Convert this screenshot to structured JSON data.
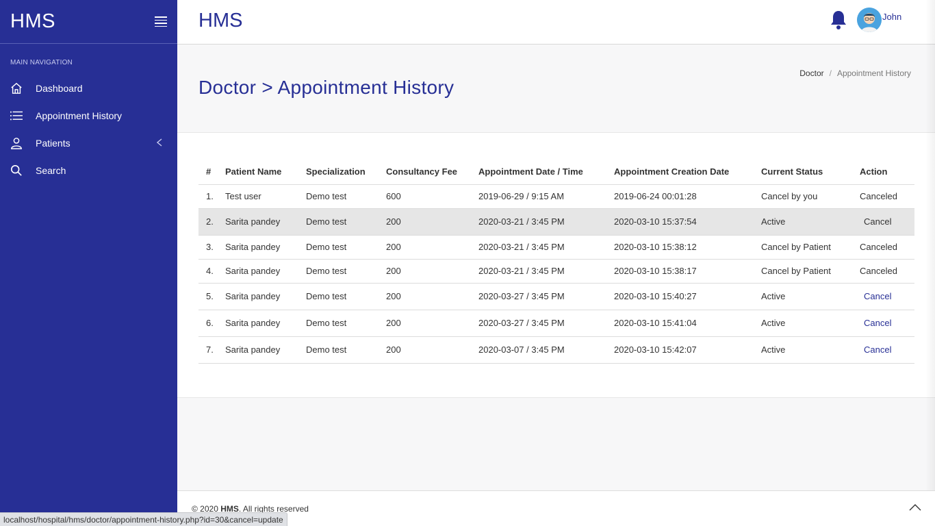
{
  "brand": "HMS",
  "sidebar": {
    "section_title": "Main Navigation",
    "items": [
      {
        "label": "Dashboard",
        "icon": "home-icon"
      },
      {
        "label": "Appointment History",
        "icon": "list-icon"
      },
      {
        "label": "Patients",
        "icon": "user-icon"
      },
      {
        "label": "Search",
        "icon": "search-icon"
      }
    ]
  },
  "topbar": {
    "title": "HMS",
    "username": "John"
  },
  "page": {
    "heading": "Doctor > Appointment History",
    "breadcrumb": [
      "Doctor",
      "Appointment History"
    ]
  },
  "table": {
    "headers": [
      "#",
      "Patient Name",
      "Specialization",
      "Consultancy Fee",
      "Appointment Date / Time",
      "Appointment Creation Date",
      "Current Status",
      "Action"
    ],
    "rows": [
      [
        "1.",
        "Test user",
        "Demo test",
        "600",
        "2019-06-29 / 9:15 AM",
        "2019-06-24 00:01:28",
        "Cancel by you",
        "Canceled"
      ],
      [
        "2.",
        "Sarita pandey",
        "Demo test",
        "200",
        "2020-03-21 / 3:45 PM",
        "2020-03-10 15:37:54",
        "Active",
        "Cancel"
      ],
      [
        "3.",
        "Sarita pandey",
        "Demo test",
        "200",
        "2020-03-21 / 3:45 PM",
        "2020-03-10 15:38:12",
        "Cancel by Patient",
        "Canceled"
      ],
      [
        "4.",
        "Sarita pandey",
        "Demo test",
        "200",
        "2020-03-21 / 3:45 PM",
        "2020-03-10 15:38:17",
        "Cancel by Patient",
        "Canceled"
      ],
      [
        "5.",
        "Sarita pandey",
        "Demo test",
        "200",
        "2020-03-27 / 3:45 PM",
        "2020-03-10 15:40:27",
        "Active",
        "Cancel"
      ],
      [
        "6.",
        "Sarita pandey",
        "Demo test",
        "200",
        "2020-03-27 / 3:45 PM",
        "2020-03-10 15:41:04",
        "Active",
        "Cancel"
      ],
      [
        "7.",
        "Sarita pandey",
        "Demo test",
        "200",
        "2020-03-07 / 3:45 PM",
        "2020-03-10 15:42:07",
        "Active",
        "Cancel"
      ]
    ]
  },
  "footer": {
    "prefix": "© 2020 ",
    "brand": "HMS",
    "suffix": ". All rights reserved"
  },
  "status_url": "localhost/hospital/hms/doctor/appointment-history.php?id=30&cancel=update",
  "colors": {
    "sidebar": "#272f95",
    "accent": "#272f95"
  }
}
